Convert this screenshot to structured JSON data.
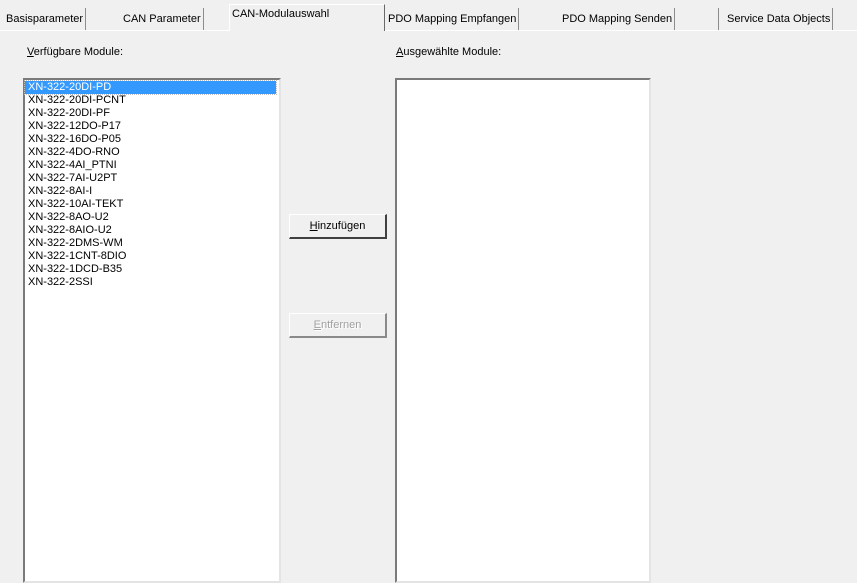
{
  "tabs": [
    {
      "label": "Basisparameter",
      "active": false
    },
    {
      "label": "CAN Parameter",
      "active": false
    },
    {
      "label": "CAN-Modulauswahl",
      "active": true
    },
    {
      "label": "PDO Mapping Empfangen",
      "active": false
    },
    {
      "label": "PDO Mapping Senden",
      "active": false
    },
    {
      "label": "Service Data Objects",
      "active": false
    }
  ],
  "available": {
    "label_mnemonic": "V",
    "label_rest": "erfügbare Module:",
    "selected_index": 0,
    "items": [
      "XN-322-20DI-PD",
      "XN-322-20DI-PCNT",
      "XN-322-20DI-PF",
      "XN-322-12DO-P17",
      "XN-322-16DO-P05",
      "XN-322-4DO-RNO",
      "XN-322-4AI_PTNI",
      "XN-322-7AI-U2PT",
      "XN-322-8AI-I",
      "XN-322-10AI-TEKT",
      "XN-322-8AO-U2",
      "XN-322-8AIO-U2",
      "XN-322-2DMS-WM",
      "XN-322-1CNT-8DIO",
      "XN-322-1DCD-B35",
      "XN-322-2SSI"
    ]
  },
  "selected": {
    "label_mnemonic": "A",
    "label_rest": "usgewählte Module:",
    "items": []
  },
  "buttons": {
    "add_mnemonic": "H",
    "add_rest": "inzufügen",
    "remove_mnemonic": "E",
    "remove_rest": "ntfernen",
    "remove_enabled": false
  },
  "colors": {
    "selection": "#3399ff",
    "dialog_bg": "#f0f0f0"
  }
}
